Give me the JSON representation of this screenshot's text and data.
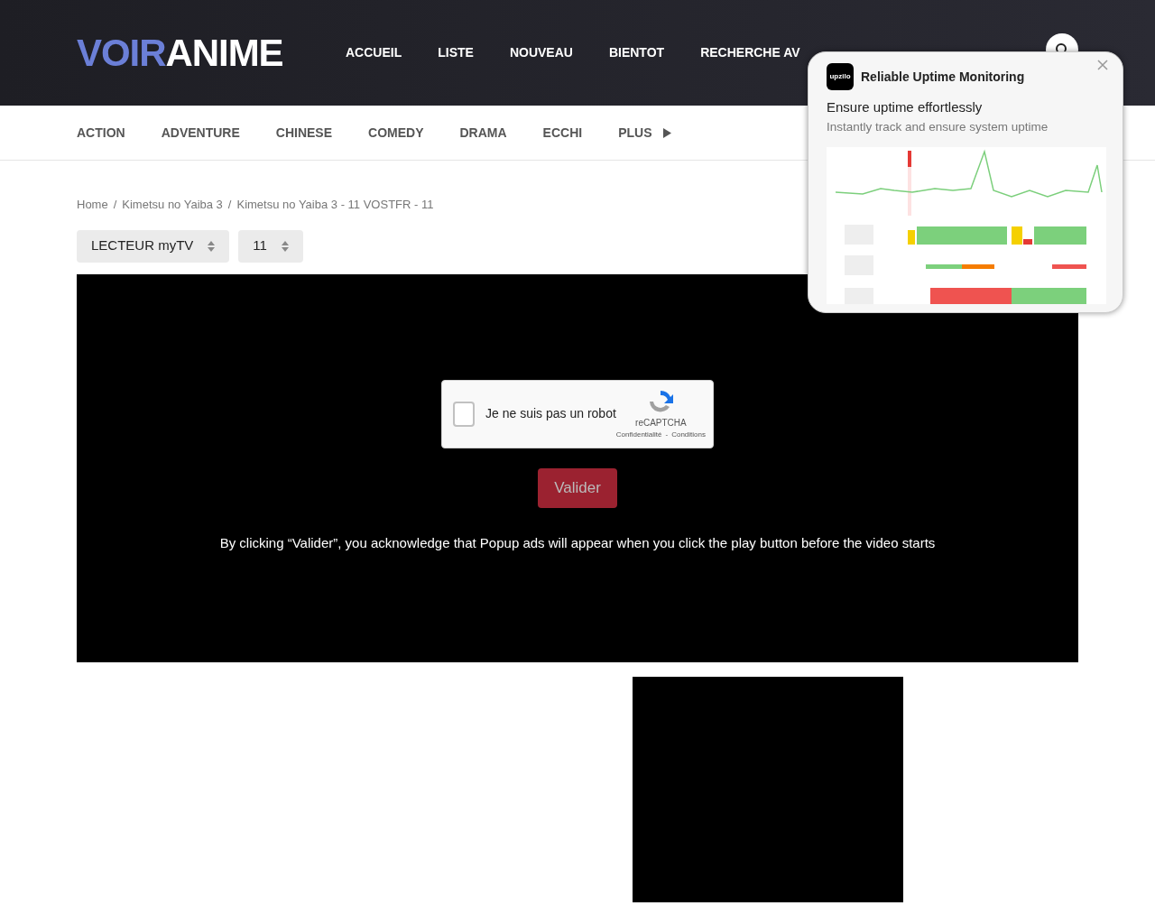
{
  "header": {
    "logo": {
      "part_1": "VOIR",
      "part_2": "ANIME"
    },
    "nav": [
      {
        "label": "ACCUEIL"
      },
      {
        "label": "LISTE"
      },
      {
        "label": "NOUVEAU"
      },
      {
        "label": "BIENTOT"
      },
      {
        "label": "RECHERCHE AV"
      }
    ]
  },
  "genres": [
    {
      "label": "ACTION"
    },
    {
      "label": "ADVENTURE"
    },
    {
      "label": "CHINESE"
    },
    {
      "label": "COMEDY"
    },
    {
      "label": "DRAMA"
    },
    {
      "label": "ECCHI"
    },
    {
      "label": "PLUS",
      "has_arrow": true
    }
  ],
  "breadcrumb": {
    "separator": "/",
    "items": [
      "Home",
      "Kimetsu no Yaiba 3",
      "Kimetsu no Yaiba 3 - 11 VOSTFR - 11"
    ]
  },
  "selects": [
    {
      "value": "LECTEUR myTV"
    },
    {
      "value": "11"
    }
  ],
  "player": {
    "captcha": {
      "label": "Je ne suis pas un robot",
      "checked": false,
      "brand": "reCAPTCHA",
      "links": [
        "Confidentialité",
        "Conditions"
      ],
      "link_separator": "-"
    },
    "button": "Valider",
    "notice": "By clicking “Valider”, you acknowledge that Popup ads will appear when you click the play button before the video starts"
  },
  "popup": {
    "logo": "upzilo",
    "title": "Reliable Uptime Monitoring",
    "headline": "Ensure uptime effortlessly",
    "text": "Instantly track and ensure system uptime"
  }
}
